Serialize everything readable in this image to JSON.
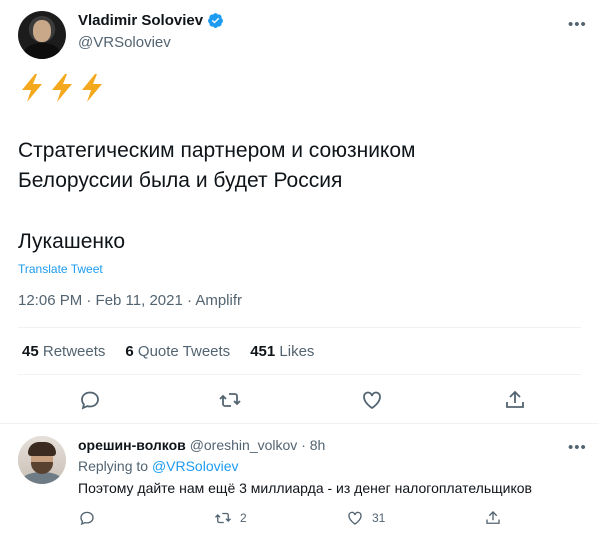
{
  "tweet": {
    "author": {
      "name": "Vladimir Soloviev",
      "handle": "@VRSoloviev",
      "verified": true
    },
    "emoji": [
      "high-voltage-icon",
      "high-voltage-icon",
      "high-voltage-icon"
    ],
    "text_lines": [
      "Стратегическим партнером и союзником",
      "Белоруссии была и будет Россия"
    ],
    "signature": "Лукашенко",
    "translate_label": "Translate Tweet",
    "meta": "12:06 PM · Feb 11, 2021 · Amplifr",
    "stats": {
      "retweets_count": "45",
      "retweets_label": "Retweets",
      "quotes_count": "6",
      "quotes_label": "Quote Tweets",
      "likes_count": "451",
      "likes_label": "Likes"
    }
  },
  "reply": {
    "name": "орешин-волков",
    "handle": "@oreshin_volkov",
    "time": "8h",
    "replying_prefix": "Replying to",
    "replying_to": "@VRSoloviev",
    "text": "Поэтому дайте нам ещё 3 миллиарда - из денег налогоплательщиков",
    "retweet_count": "2",
    "like_count": "31"
  },
  "colors": {
    "accent": "#1d9bf0",
    "secondary_text": "#536471",
    "primary_text": "#0f1419",
    "lightning": "#f4a81d"
  }
}
